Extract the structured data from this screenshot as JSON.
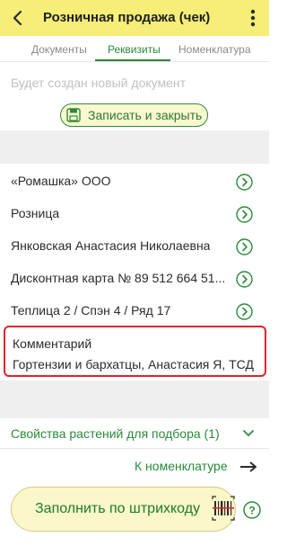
{
  "header": {
    "title": "Розничная продажа (чек)",
    "back_icon": "chevron-left-icon",
    "menu_icon": "more-vertical-icon",
    "background": "#f6ee77"
  },
  "tabs": [
    {
      "label": "Документы",
      "active": false
    },
    {
      "label": "Реквизиты",
      "active": true
    },
    {
      "label": "Номенклатура",
      "active": false
    }
  ],
  "notice": "Будет создан новый документ",
  "save_button": {
    "label": "Записать и закрыть",
    "icon": "save-icon"
  },
  "rows": [
    {
      "value": "«Ромашка» ООО",
      "icon": "chevron-right-circle-icon"
    },
    {
      "value": "Розница",
      "icon": "chevron-right-circle-icon"
    },
    {
      "value": "Янковская Анастасия Николаевна",
      "icon": "chevron-right-circle-icon"
    },
    {
      "value": "Дисконтная карта № 89 512 664 51...",
      "icon": "chevron-right-circle-icon"
    },
    {
      "value": "Теплица 2 / Спэн 4 / Ряд 17",
      "icon": "chevron-right-circle-icon"
    }
  ],
  "comment": {
    "label": "Комментарий",
    "value": "Гортензии и бархатцы, Анастасия Я, ТСД",
    "highlight_color": "#e0242c"
  },
  "properties": {
    "label": "Свойства растений для подбора (1)",
    "icon": "chevron-down-icon"
  },
  "nomenclature_link": {
    "label": "К номенклатуре",
    "icon": "arrow-right-icon"
  },
  "scan_button": {
    "label": "Заполнить по штрихкоду",
    "icon": "barcode-scan-icon"
  },
  "help_icon": "help-icon",
  "accent_color": "#2a8a3a"
}
